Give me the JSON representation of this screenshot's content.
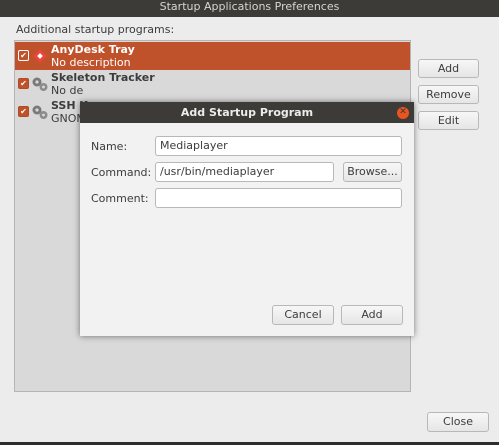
{
  "window": {
    "title": "Startup Applications Preferences",
    "section_label": "Additional startup programs:",
    "close_label": "Close"
  },
  "programs": [
    {
      "name": "AnyDesk Tray",
      "description": "No description",
      "checked": true,
      "selected": true,
      "icon": "anydesk-icon"
    },
    {
      "name": "Skeleton Tracker",
      "description": "No de",
      "checked": true,
      "selected": false,
      "icon": "gears-icon"
    },
    {
      "name": "SSH K",
      "description": "GNOM",
      "checked": true,
      "selected": false,
      "icon": "gears-icon"
    }
  ],
  "side_buttons": {
    "add": "Add",
    "remove": "Remove",
    "edit": "Edit"
  },
  "dialog": {
    "title": "Add Startup Program",
    "name_label": "Name:",
    "name_value": "Mediaplayer",
    "command_label": "Command:",
    "command_value": "/usr/bin/mediaplayer",
    "comment_label": "Comment:",
    "comment_value": "",
    "browse_label": "Browse...",
    "cancel_label": "Cancel",
    "add_label": "Add"
  },
  "colors": {
    "accent": "#c0522b",
    "titlebar": "#3c3b37",
    "close_button": "#e95420"
  }
}
